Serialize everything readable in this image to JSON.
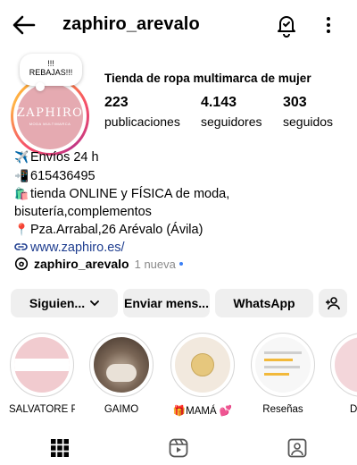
{
  "header": {
    "username": "zaphiro_arevalo"
  },
  "profile": {
    "note": "!!!\nREBAJAS!!!",
    "logo_text": "ZAPHIRO",
    "logo_sub": "MODA MULTIMARCA",
    "category": "Tienda de ropa multimarca de mujer",
    "stats": {
      "posts_count": "223",
      "posts_label": "publicaciones",
      "followers_count": "4.143",
      "followers_label": "seguidores",
      "following_count": "303",
      "following_label": "seguidos"
    },
    "bio": {
      "line1": "Envíos 24 h",
      "line2": "615436495",
      "line3": "tienda ONLINE y FÍSICA de moda,",
      "line4": "bisutería,complementos",
      "line5": "Pza.Arrabal,26 Arévalo (Ávila)",
      "link": "www.zaphiro.es/"
    },
    "threads": {
      "name": "zaphiro_arevalo",
      "badge": "1 nueva"
    }
  },
  "actions": {
    "following": "Siguien...",
    "message": "Enviar mens...",
    "whatsapp": "WhatsApp"
  },
  "highlights": [
    {
      "label": "SALVATORE P..."
    },
    {
      "label": "GAIMO"
    },
    {
      "label": "🎁MAMÁ 💕"
    },
    {
      "label": "Reseñas"
    },
    {
      "label": "D"
    }
  ],
  "colors": {
    "brand_pink": "#e5aab1",
    "link_blue": "#1e3d8f",
    "button_gray": "#efefef"
  },
  "icons": [
    "back-arrow-icon",
    "notification-bell-icon",
    "more-options-icon",
    "threads-icon",
    "link-icon",
    "add-person-icon",
    "grid-icon",
    "reels-icon",
    "tagged-icon"
  ]
}
